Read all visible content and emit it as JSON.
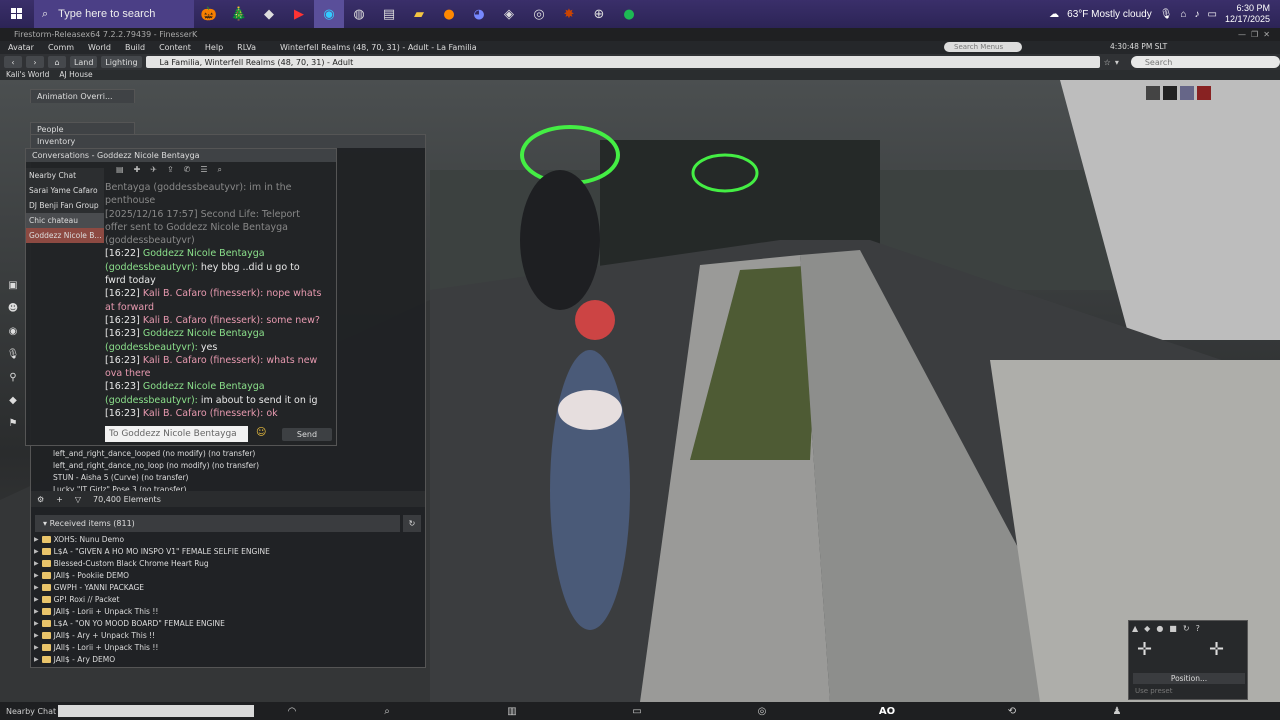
{
  "taskbar": {
    "search_placeholder": "Type here to search",
    "weather": "63°F  Mostly cloudy",
    "time": "6:30 PM",
    "date": "12/17/2025"
  },
  "window_title": "Firestorm-Releasex64 7.2.2.79439 - FinesserK",
  "menu": [
    "Avatar",
    "Comm",
    "World",
    "Build",
    "Content",
    "Help",
    "RLVa"
  ],
  "region_title": "Winterfell Realms (48, 70, 31) - Adult - La Familia",
  "search_menus": "Search Menus",
  "slt_time": "4:30:48 PM SLT",
  "nav": {
    "land": "Land",
    "lighting": "Lighting",
    "location": "La Familia, Winterfell Realms (48, 70, 31) - Adult",
    "search_placeholder": "Search"
  },
  "favorites": [
    "Kali's World",
    "AJ House"
  ],
  "panels": {
    "anim_override": "Animation Overri...",
    "people": "People",
    "inventory": "Inventory",
    "conversations": "Conversations - Goddezz Nicole Bentayga"
  },
  "chat_list": [
    "Nearby Chat",
    "Sarai Yame Cafaro",
    "DJ Benji Fan Group",
    "Chic chateau",
    "Goddezz Nicole B..."
  ],
  "messages": [
    {
      "t": "",
      "n": "",
      "c": "dim",
      "x": "Bentayga (goddessbeautyvr): im in the penthouse"
    },
    {
      "t": "[2025/12/16 17:57]",
      "n": "",
      "c": "dim",
      "x": "Second Life: Teleport offer sent to Goddezz Nicole Bentayga (goddessbeautyvr)"
    },
    {
      "t": "[16:22]",
      "n": "Goddezz Nicole Bentayga (goddessbeautyvr):",
      "c": "gr",
      "x": "hey bbg ..did u go to fwrd today"
    },
    {
      "t": "[16:22]",
      "n": "Kali B. Cafaro (finesserk):",
      "c": "pk",
      "x": "nope whats at forward"
    },
    {
      "t": "[16:23]",
      "n": "Kali B. Cafaro (finesserk):",
      "c": "pk",
      "x": "some new?"
    },
    {
      "t": "[16:23]",
      "n": "Goddezz Nicole Bentayga (goddessbeautyvr):",
      "c": "gr",
      "x": "yes"
    },
    {
      "t": "[16:23]",
      "n": "Kali B. Cafaro (finesserk):",
      "c": "pk",
      "x": "whats new ova there"
    },
    {
      "t": "[16:23]",
      "n": "Goddezz Nicole Bentayga (goddessbeautyvr):",
      "c": "gr",
      "x": "im about to send it on ig"
    },
    {
      "t": "[16:23]",
      "n": "Kali B. Cafaro (finesserk):",
      "c": "pk",
      "x": "ok"
    }
  ],
  "chat_input_placeholder": "To Goddezz Nicole Bentayga",
  "send_label": "Send",
  "inv_anims": [
    "left_and_right_dance_looped (no modify) (no transfer)",
    "left_and_right_dance_no_loop (no modify) (no transfer)",
    "STUN - Aisha 5 (Curve) (no transfer)",
    "Lucky \"IT Girlz\" Pose 3 (no transfer)"
  ],
  "elements_count": "70,400 Elements",
  "received_title": "Received items (811)",
  "received_items": [
    "XOHS: Nunu Demo",
    "L$A - \"GIVEN A HO MO INSPO V1\" FEMALE SELFIE ENGINE",
    "Blessed-Custom Black Chrome Heart Rug",
    "JAll$ - Pookiie DEMO",
    "GWPH - YANNI PACKAGE",
    "GP! Roxi // Packet",
    "JAll$ - Lorii + Unpack This !!",
    "L$A - \"ON YO MOOD BOARD\" FEMALE ENGINE",
    "JAll$ - Ary + Unpack This !!",
    "JAll$ - Lorii + Unpack This !!",
    "JAll$ - Ary DEMO"
  ],
  "bottom": {
    "nearby_chat": "Nearby Chat",
    "ao": "AO"
  },
  "camera": {
    "position": "Position...",
    "use_preset": "Use preset"
  }
}
